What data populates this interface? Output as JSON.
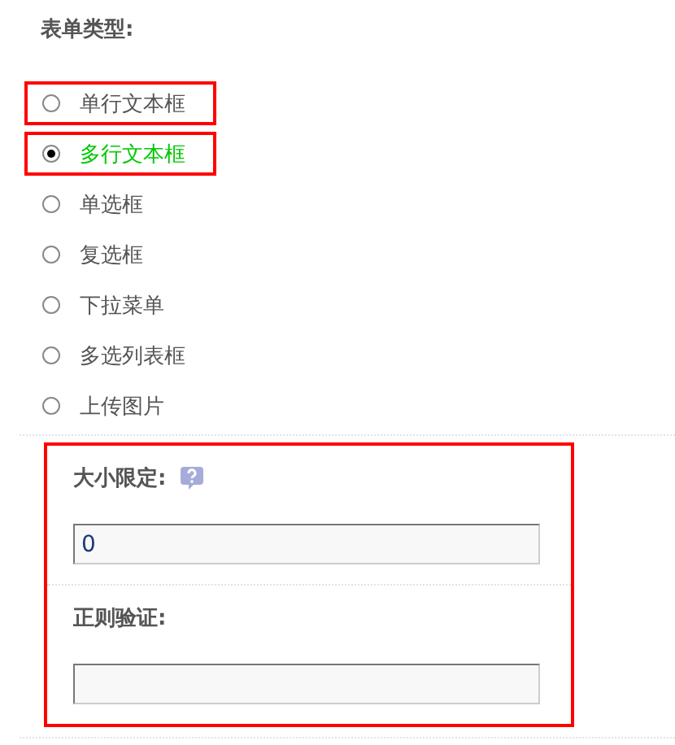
{
  "form_type": {
    "label": "表单类型:",
    "options": [
      {
        "label": "单行文本框",
        "selected": false,
        "highlighted": true
      },
      {
        "label": "多行文本框",
        "selected": true,
        "highlighted": true
      },
      {
        "label": "单选框",
        "selected": false,
        "highlighted": false
      },
      {
        "label": "复选框",
        "selected": false,
        "highlighted": false
      },
      {
        "label": "下拉菜单",
        "selected": false,
        "highlighted": false
      },
      {
        "label": "多选列表框",
        "selected": false,
        "highlighted": false
      },
      {
        "label": "上传图片",
        "selected": false,
        "highlighted": false
      }
    ]
  },
  "settings": {
    "highlighted": true,
    "fields": [
      {
        "label": "大小限定:",
        "help": true,
        "value": "0"
      },
      {
        "label": "正则验证:",
        "help": false
      }
    ]
  }
}
